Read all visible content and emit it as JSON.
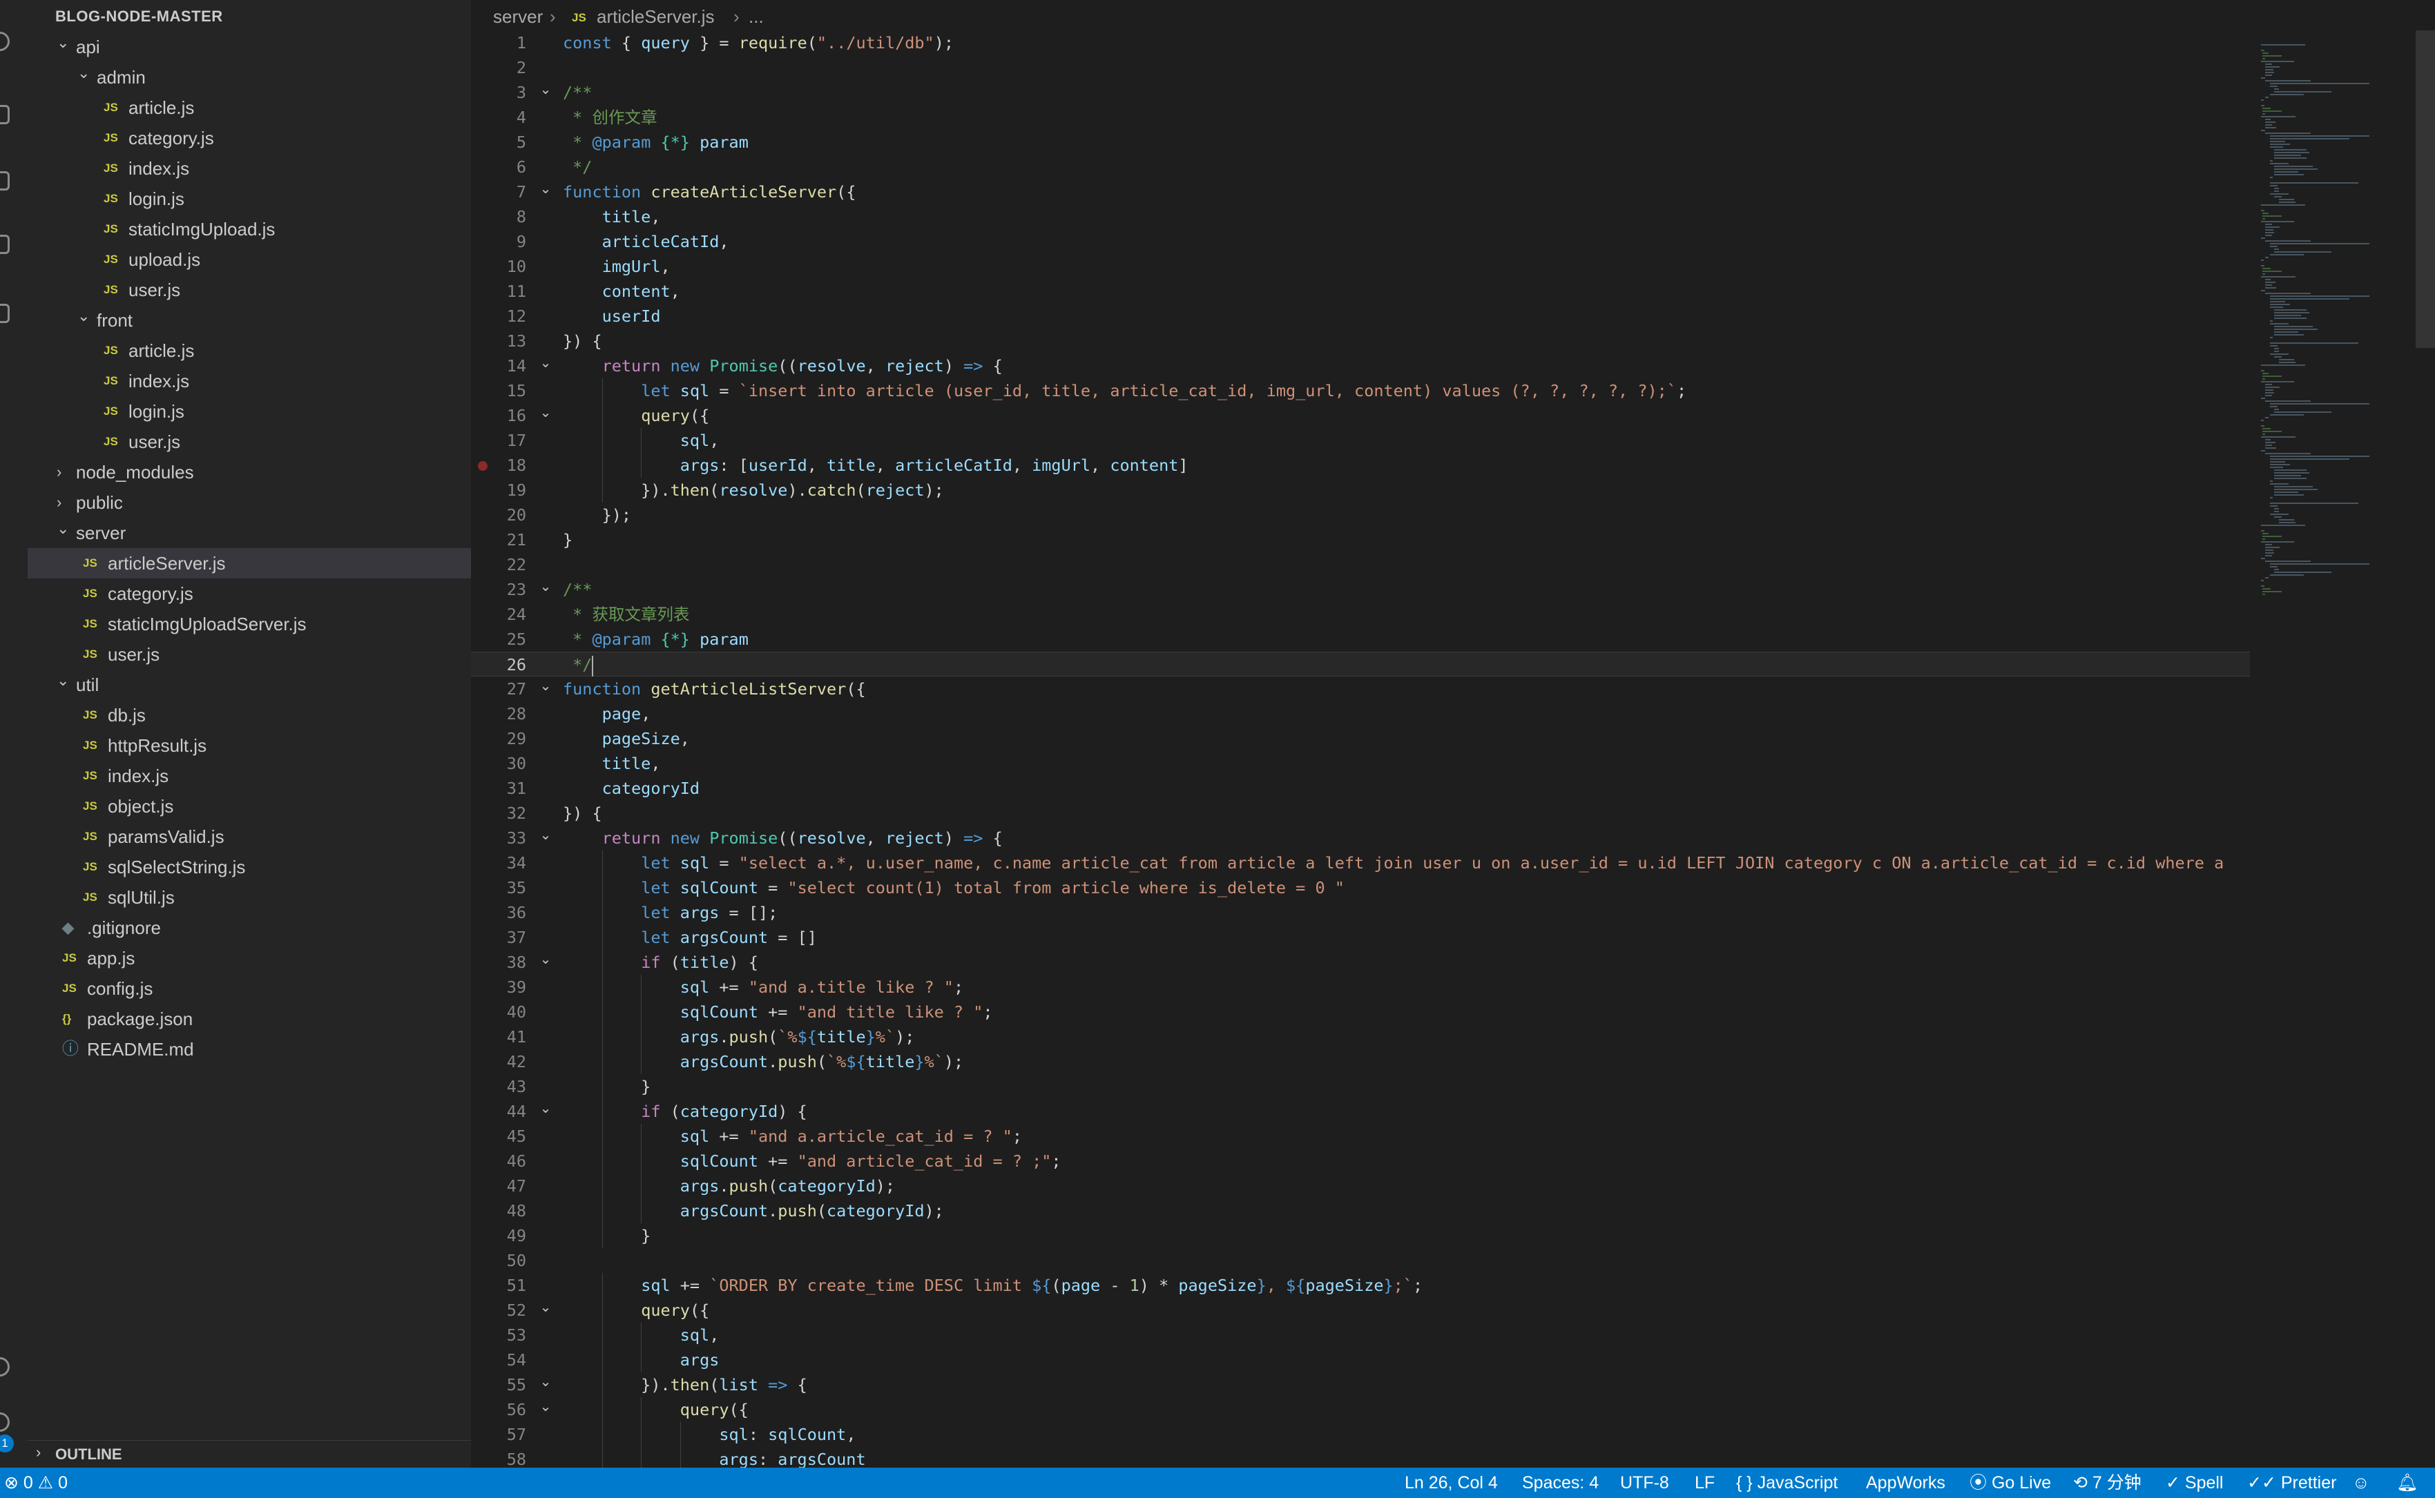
{
  "explorer": {
    "title": "BLOG-NODE-MASTER",
    "items": [
      {
        "label": "api",
        "type": "folder",
        "open": true,
        "depth": 0
      },
      {
        "label": "admin",
        "type": "folder",
        "open": true,
        "depth": 1
      },
      {
        "label": "article.js",
        "type": "js",
        "depth": 2
      },
      {
        "label": "category.js",
        "type": "js",
        "depth": 2
      },
      {
        "label": "index.js",
        "type": "js",
        "depth": 2
      },
      {
        "label": "login.js",
        "type": "js",
        "depth": 2
      },
      {
        "label": "staticImgUpload.js",
        "type": "js",
        "depth": 2
      },
      {
        "label": "upload.js",
        "type": "js",
        "depth": 2
      },
      {
        "label": "user.js",
        "type": "js",
        "depth": 2
      },
      {
        "label": "front",
        "type": "folder",
        "open": true,
        "depth": 1
      },
      {
        "label": "article.js",
        "type": "js",
        "depth": 2
      },
      {
        "label": "index.js",
        "type": "js",
        "depth": 2
      },
      {
        "label": "login.js",
        "type": "js",
        "depth": 2
      },
      {
        "label": "user.js",
        "type": "js",
        "depth": 2
      },
      {
        "label": "node_modules",
        "type": "folder",
        "open": false,
        "depth": 0
      },
      {
        "label": "public",
        "type": "folder",
        "open": false,
        "depth": 0
      },
      {
        "label": "server",
        "type": "folder",
        "open": true,
        "depth": 0
      },
      {
        "label": "articleServer.js",
        "type": "js",
        "depth": 1,
        "selected": true
      },
      {
        "label": "category.js",
        "type": "js",
        "depth": 1
      },
      {
        "label": "staticImgUploadServer.js",
        "type": "js",
        "depth": 1
      },
      {
        "label": "user.js",
        "type": "js",
        "depth": 1
      },
      {
        "label": "util",
        "type": "folder",
        "open": true,
        "depth": 0
      },
      {
        "label": "db.js",
        "type": "js",
        "depth": 1
      },
      {
        "label": "httpResult.js",
        "type": "js",
        "depth": 1
      },
      {
        "label": "index.js",
        "type": "js",
        "depth": 1
      },
      {
        "label": "object.js",
        "type": "js",
        "depth": 1
      },
      {
        "label": "paramsValid.js",
        "type": "js",
        "depth": 1
      },
      {
        "label": "sqlSelectString.js",
        "type": "js",
        "depth": 1
      },
      {
        "label": "sqlUtil.js",
        "type": "js",
        "depth": 1
      },
      {
        "label": ".gitignore",
        "type": "git",
        "depth": 0
      },
      {
        "label": "app.js",
        "type": "js",
        "depth": 0
      },
      {
        "label": "config.js",
        "type": "js",
        "depth": 0
      },
      {
        "label": "package.json",
        "type": "json",
        "depth": 0
      },
      {
        "label": "README.md",
        "type": "info",
        "depth": 0
      }
    ],
    "outline_label": "OUTLINE"
  },
  "breadcrumb": {
    "folder": "server",
    "file_icon": "JS",
    "file": "articleServer.js",
    "more": "..."
  },
  "icons": {
    "js": "JS",
    "json": "{}",
    "info": "ⓘ",
    "git": "◆",
    "chevron_open": "⌄",
    "chevron_closed": "›",
    "fold": "⌄"
  },
  "editor": {
    "cursor_line": 26,
    "breakpoint_line": 18,
    "fold_lines": [
      3,
      7,
      14,
      16,
      23,
      27,
      33,
      38,
      44,
      52,
      55,
      56
    ],
    "lines": [
      [
        [
          "kw",
          "const"
        ],
        [
          "tok",
          " { "
        ],
        [
          "vr",
          "query"
        ],
        [
          "tok",
          " } = "
        ],
        [
          "fn",
          "require"
        ],
        [
          "tok",
          "("
        ],
        [
          "str",
          "\"../util/db\""
        ],
        [
          "tok",
          ");"
        ]
      ],
      [],
      [
        [
          "com",
          "/**"
        ]
      ],
      [
        [
          "com",
          " * 创作文章"
        ]
      ],
      [
        [
          "com",
          " * "
        ],
        [
          "kw",
          "@param"
        ],
        [
          "com",
          " "
        ],
        [
          "cls",
          "{*}"
        ],
        [
          "com",
          " "
        ],
        [
          "vr",
          "param"
        ]
      ],
      [
        [
          "com",
          " */"
        ]
      ],
      [
        [
          "kw",
          "function"
        ],
        [
          "tok",
          " "
        ],
        [
          "fn",
          "createArticleServer"
        ],
        [
          "tok",
          "({"
        ]
      ],
      [
        [
          "tok",
          "    "
        ],
        [
          "vr",
          "title"
        ],
        [
          "tok",
          ","
        ]
      ],
      [
        [
          "tok",
          "    "
        ],
        [
          "vr",
          "articleCatId"
        ],
        [
          "tok",
          ","
        ]
      ],
      [
        [
          "tok",
          "    "
        ],
        [
          "vr",
          "imgUrl"
        ],
        [
          "tok",
          ","
        ]
      ],
      [
        [
          "tok",
          "    "
        ],
        [
          "vr",
          "content"
        ],
        [
          "tok",
          ","
        ]
      ],
      [
        [
          "tok",
          "    "
        ],
        [
          "vr",
          "userId"
        ]
      ],
      [
        [
          "tok",
          "}) {"
        ]
      ],
      [
        [
          "tok",
          "    "
        ],
        [
          "kw2",
          "return"
        ],
        [
          "tok",
          " "
        ],
        [
          "kw",
          "new"
        ],
        [
          "tok",
          " "
        ],
        [
          "cls",
          "Promise"
        ],
        [
          "tok",
          "(("
        ],
        [
          "vr",
          "resolve"
        ],
        [
          "tok",
          ", "
        ],
        [
          "vr",
          "reject"
        ],
        [
          "tok",
          ") "
        ],
        [
          "kw",
          "=>"
        ],
        [
          "tok",
          " {"
        ]
      ],
      [
        [
          "tok",
          "        "
        ],
        [
          "kw",
          "let"
        ],
        [
          "tok",
          " "
        ],
        [
          "vr",
          "sql"
        ],
        [
          "tok",
          " = "
        ],
        [
          "str",
          "`insert into article (user_id, title, article_cat_id, img_url, content) values (?, ?, ?, ?, ?);`"
        ],
        [
          "tok",
          ";"
        ]
      ],
      [
        [
          "tok",
          "        "
        ],
        [
          "fn",
          "query"
        ],
        [
          "tok",
          "({"
        ]
      ],
      [
        [
          "tok",
          "            "
        ],
        [
          "vr",
          "sql"
        ],
        [
          "tok",
          ","
        ]
      ],
      [
        [
          "tok",
          "            "
        ],
        [
          "vr",
          "args"
        ],
        [
          "tok",
          ": ["
        ],
        [
          "vr",
          "userId"
        ],
        [
          "tok",
          ", "
        ],
        [
          "vr",
          "title"
        ],
        [
          "tok",
          ", "
        ],
        [
          "vr",
          "articleCatId"
        ],
        [
          "tok",
          ", "
        ],
        [
          "vr",
          "imgUrl"
        ],
        [
          "tok",
          ", "
        ],
        [
          "vr",
          "content"
        ],
        [
          "tok",
          "]"
        ]
      ],
      [
        [
          "tok",
          "        })."
        ],
        [
          "fn",
          "then"
        ],
        [
          "tok",
          "("
        ],
        [
          "vr",
          "resolve"
        ],
        [
          "tok",
          ")."
        ],
        [
          "fn",
          "catch"
        ],
        [
          "tok",
          "("
        ],
        [
          "vr",
          "reject"
        ],
        [
          "tok",
          ");"
        ]
      ],
      [
        [
          "tok",
          "    });"
        ]
      ],
      [
        [
          "tok",
          "}"
        ]
      ],
      [],
      [
        [
          "com",
          "/**"
        ]
      ],
      [
        [
          "com",
          " * 获取文章列表"
        ]
      ],
      [
        [
          "com",
          " * "
        ],
        [
          "kw",
          "@param"
        ],
        [
          "com",
          " "
        ],
        [
          "cls",
          "{*}"
        ],
        [
          "com",
          " "
        ],
        [
          "vr",
          "param"
        ]
      ],
      [
        [
          "com",
          " */"
        ]
      ],
      [
        [
          "kw",
          "function"
        ],
        [
          "tok",
          " "
        ],
        [
          "fn",
          "getArticleListServer"
        ],
        [
          "tok",
          "({"
        ]
      ],
      [
        [
          "tok",
          "    "
        ],
        [
          "vr",
          "page"
        ],
        [
          "tok",
          ","
        ]
      ],
      [
        [
          "tok",
          "    "
        ],
        [
          "vr",
          "pageSize"
        ],
        [
          "tok",
          ","
        ]
      ],
      [
        [
          "tok",
          "    "
        ],
        [
          "vr",
          "title"
        ],
        [
          "tok",
          ","
        ]
      ],
      [
        [
          "tok",
          "    "
        ],
        [
          "vr",
          "categoryId"
        ]
      ],
      [
        [
          "tok",
          "}) {"
        ]
      ],
      [
        [
          "tok",
          "    "
        ],
        [
          "kw2",
          "return"
        ],
        [
          "tok",
          " "
        ],
        [
          "kw",
          "new"
        ],
        [
          "tok",
          " "
        ],
        [
          "cls",
          "Promise"
        ],
        [
          "tok",
          "(("
        ],
        [
          "vr",
          "resolve"
        ],
        [
          "tok",
          ", "
        ],
        [
          "vr",
          "reject"
        ],
        [
          "tok",
          ") "
        ],
        [
          "kw",
          "=>"
        ],
        [
          "tok",
          " {"
        ]
      ],
      [
        [
          "tok",
          "        "
        ],
        [
          "kw",
          "let"
        ],
        [
          "tok",
          " "
        ],
        [
          "vr",
          "sql"
        ],
        [
          "tok",
          " = "
        ],
        [
          "str",
          "\"select a.*, u.user_name, c.name article_cat from article a left join user u on a.user_id = u.id LEFT JOIN category c ON a.article_cat_id = c.id where a"
        ]
      ],
      [
        [
          "tok",
          "        "
        ],
        [
          "kw",
          "let"
        ],
        [
          "tok",
          " "
        ],
        [
          "vr",
          "sqlCount"
        ],
        [
          "tok",
          " = "
        ],
        [
          "str",
          "\"select count(1) total from article where is_delete = 0 \""
        ]
      ],
      [
        [
          "tok",
          "        "
        ],
        [
          "kw",
          "let"
        ],
        [
          "tok",
          " "
        ],
        [
          "vr",
          "args"
        ],
        [
          "tok",
          " = [];"
        ]
      ],
      [
        [
          "tok",
          "        "
        ],
        [
          "kw",
          "let"
        ],
        [
          "tok",
          " "
        ],
        [
          "vr",
          "argsCount"
        ],
        [
          "tok",
          " = []"
        ]
      ],
      [
        [
          "tok",
          "        "
        ],
        [
          "kw2",
          "if"
        ],
        [
          "tok",
          " ("
        ],
        [
          "vr",
          "title"
        ],
        [
          "tok",
          ") {"
        ]
      ],
      [
        [
          "tok",
          "            "
        ],
        [
          "vr",
          "sql"
        ],
        [
          "tok",
          " += "
        ],
        [
          "str",
          "\"and a.title like ? \""
        ],
        [
          "tok",
          ";"
        ]
      ],
      [
        [
          "tok",
          "            "
        ],
        [
          "vr",
          "sqlCount"
        ],
        [
          "tok",
          " += "
        ],
        [
          "str",
          "\"and title like ? \""
        ],
        [
          "tok",
          ";"
        ]
      ],
      [
        [
          "tok",
          "            "
        ],
        [
          "vr",
          "args"
        ],
        [
          "tok",
          "."
        ],
        [
          "fn",
          "push"
        ],
        [
          "tok",
          "("
        ],
        [
          "str",
          "`%"
        ],
        [
          "kw",
          "${"
        ],
        [
          "vr",
          "title"
        ],
        [
          "kw",
          "}"
        ],
        [
          "str",
          "%`"
        ],
        [
          "tok",
          ");"
        ]
      ],
      [
        [
          "tok",
          "            "
        ],
        [
          "vr",
          "argsCount"
        ],
        [
          "tok",
          "."
        ],
        [
          "fn",
          "push"
        ],
        [
          "tok",
          "("
        ],
        [
          "str",
          "`%"
        ],
        [
          "kw",
          "${"
        ],
        [
          "vr",
          "title"
        ],
        [
          "kw",
          "}"
        ],
        [
          "str",
          "%`"
        ],
        [
          "tok",
          ");"
        ]
      ],
      [
        [
          "tok",
          "        }"
        ]
      ],
      [
        [
          "tok",
          "        "
        ],
        [
          "kw2",
          "if"
        ],
        [
          "tok",
          " ("
        ],
        [
          "vr",
          "categoryId"
        ],
        [
          "tok",
          ") {"
        ]
      ],
      [
        [
          "tok",
          "            "
        ],
        [
          "vr",
          "sql"
        ],
        [
          "tok",
          " += "
        ],
        [
          "str",
          "\"and a.article_cat_id = ? \""
        ],
        [
          "tok",
          ";"
        ]
      ],
      [
        [
          "tok",
          "            "
        ],
        [
          "vr",
          "sqlCount"
        ],
        [
          "tok",
          " += "
        ],
        [
          "str",
          "\"and article_cat_id = ? ;\""
        ],
        [
          "tok",
          ";"
        ]
      ],
      [
        [
          "tok",
          "            "
        ],
        [
          "vr",
          "args"
        ],
        [
          "tok",
          "."
        ],
        [
          "fn",
          "push"
        ],
        [
          "tok",
          "("
        ],
        [
          "vr",
          "categoryId"
        ],
        [
          "tok",
          ");"
        ]
      ],
      [
        [
          "tok",
          "            "
        ],
        [
          "vr",
          "argsCount"
        ],
        [
          "tok",
          "."
        ],
        [
          "fn",
          "push"
        ],
        [
          "tok",
          "("
        ],
        [
          "vr",
          "categoryId"
        ],
        [
          "tok",
          ");"
        ]
      ],
      [
        [
          "tok",
          "        }"
        ]
      ],
      [],
      [
        [
          "tok",
          "        "
        ],
        [
          "vr",
          "sql"
        ],
        [
          "tok",
          " += "
        ],
        [
          "str",
          "`ORDER BY create_time DESC limit "
        ],
        [
          "kw",
          "${"
        ],
        [
          "tok",
          "("
        ],
        [
          "vr",
          "page"
        ],
        [
          "tok",
          " - "
        ],
        [
          "num",
          "1"
        ],
        [
          "tok",
          ") * "
        ],
        [
          "vr",
          "pageSize"
        ],
        [
          "kw",
          "}"
        ],
        [
          "str",
          ", "
        ],
        [
          "kw",
          "${"
        ],
        [
          "vr",
          "pageSize"
        ],
        [
          "kw",
          "}"
        ],
        [
          "str",
          ";`"
        ],
        [
          "tok",
          ";"
        ]
      ],
      [
        [
          "tok",
          "        "
        ],
        [
          "fn",
          "query"
        ],
        [
          "tok",
          "({"
        ]
      ],
      [
        [
          "tok",
          "            "
        ],
        [
          "vr",
          "sql"
        ],
        [
          "tok",
          ","
        ]
      ],
      [
        [
          "tok",
          "            "
        ],
        [
          "vr",
          "args"
        ]
      ],
      [
        [
          "tok",
          "        })."
        ],
        [
          "fn",
          "then"
        ],
        [
          "tok",
          "("
        ],
        [
          "vr",
          "list"
        ],
        [
          "tok",
          " "
        ],
        [
          "kw",
          "=>"
        ],
        [
          "tok",
          " {"
        ]
      ],
      [
        [
          "tok",
          "            "
        ],
        [
          "fn",
          "query"
        ],
        [
          "tok",
          "({"
        ]
      ],
      [
        [
          "tok",
          "                "
        ],
        [
          "vr",
          "sql"
        ],
        [
          "tok",
          ": "
        ],
        [
          "vr",
          "sqlCount"
        ],
        [
          "tok",
          ","
        ]
      ],
      [
        [
          "tok",
          "                "
        ],
        [
          "vr",
          "args"
        ],
        [
          "tok",
          ": "
        ],
        [
          "vr",
          "argsCount"
        ]
      ]
    ]
  },
  "statusbar": {
    "problems": "⊗ 0 ⚠ 0",
    "position": "Ln 26, Col 4",
    "spaces": "Spaces: 4",
    "encoding": "UTF-8",
    "eol": "LF",
    "language": "{ } JavaScript",
    "appworks": "AppWorks",
    "golive": "⦿ Go Live",
    "time": "⟲ 7 分钟",
    "spell": "✓ Spell",
    "prettier": "✓✓ Prettier",
    "feedback_icon": "☺",
    "bell_icon": "🔔︎"
  },
  "activity_badge": "1",
  "colors": {
    "accent": "#007acc",
    "js_icon": "#cbcb41",
    "selection": "#37373d"
  }
}
